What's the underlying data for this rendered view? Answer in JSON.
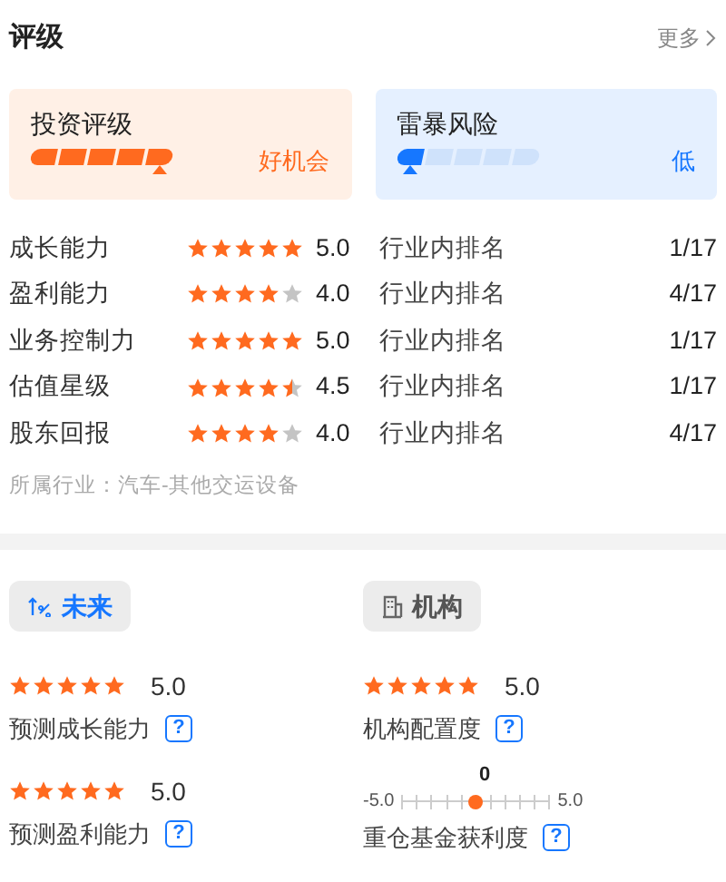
{
  "header": {
    "title": "评级",
    "more": "更多"
  },
  "cards": [
    {
      "kind": "invest",
      "title": "投资评级",
      "segments": [
        {
          "on": true
        },
        {
          "on": true
        },
        {
          "on": true
        },
        {
          "on": true
        },
        {
          "on": true
        }
      ],
      "verdict": "好机会"
    },
    {
      "kind": "risk",
      "title": "雷暴风险",
      "segments": [
        {
          "on": true
        },
        {
          "on": false
        },
        {
          "on": false
        },
        {
          "on": false
        },
        {
          "on": false
        }
      ],
      "verdict": "低"
    }
  ],
  "ratings": [
    {
      "name": "成长能力",
      "stars": 5,
      "score": "5.0",
      "rank_label": "行业内排名",
      "rank": "1/17"
    },
    {
      "name": "盈利能力",
      "stars": 4,
      "score": "4.0",
      "rank_label": "行业内排名",
      "rank": "4/17"
    },
    {
      "name": "业务控制力",
      "stars": 5,
      "score": "5.0",
      "rank_label": "行业内排名",
      "rank": "1/17"
    },
    {
      "name": "估值星级",
      "stars": 4.5,
      "score": "4.5",
      "rank_label": "行业内排名",
      "rank": "1/17"
    },
    {
      "name": "股东回报",
      "stars": 4,
      "score": "4.0",
      "rank_label": "行业内排名",
      "rank": "4/17"
    }
  ],
  "industry": "所属行业：汽车-其他交运设备",
  "sections": [
    {
      "kind": "future",
      "title": "未来",
      "selected": true,
      "items": [
        {
          "kind": "stars",
          "stars": 5,
          "score": "5.0",
          "label": "预测成长能力",
          "help": "?"
        },
        {
          "kind": "stars",
          "stars": 5,
          "score": "5.0",
          "label": "预测盈利能力",
          "help": "?"
        }
      ]
    },
    {
      "kind": "institution",
      "title": "机构",
      "selected": false,
      "items": [
        {
          "kind": "stars",
          "stars": 5,
          "score": "5.0",
          "label": "机构配置度",
          "help": "?"
        },
        {
          "kind": "scale",
          "marker_text": "0",
          "min": "-5.0",
          "max": "5.0",
          "level": 0.5,
          "label": "重仓基金获利度",
          "help": "?"
        }
      ]
    }
  ]
}
